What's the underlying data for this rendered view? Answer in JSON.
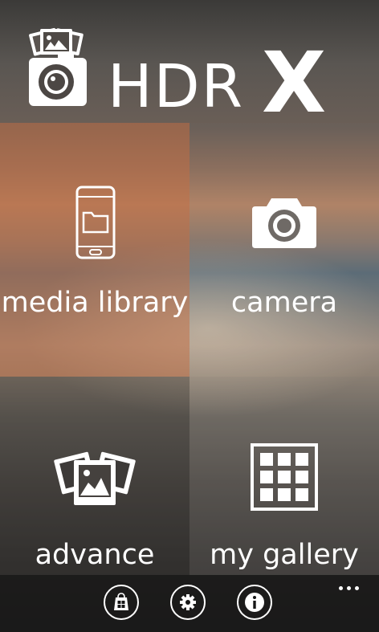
{
  "header": {
    "title": "HDR",
    "title_suffix": "X",
    "logo_icon": "camera-with-photos-icon"
  },
  "tiles": [
    {
      "label": "media library",
      "icon": "phone-folder-icon"
    },
    {
      "label": "camera",
      "icon": "camera-icon"
    },
    {
      "label": "advance",
      "icon": "photo-stack-icon"
    },
    {
      "label": "my gallery",
      "icon": "grid-icon"
    }
  ],
  "appbar": {
    "buttons": [
      {
        "icon": "store-icon"
      },
      {
        "icon": "settings-gear-icon"
      },
      {
        "icon": "info-icon"
      }
    ],
    "more_icon": "ellipsis-icon"
  },
  "colors": {
    "tile_highlight": "#be6e46",
    "appbar": "#161616",
    "foreground": "#ffffff"
  }
}
